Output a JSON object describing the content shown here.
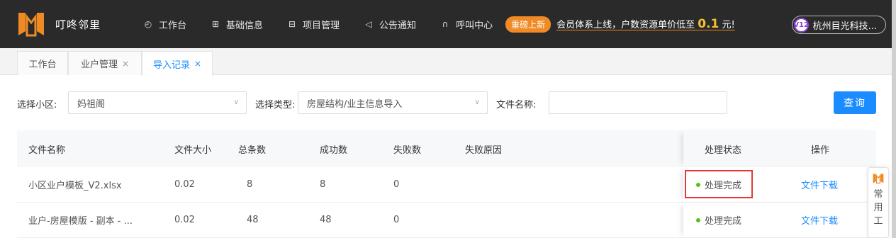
{
  "app": {
    "name": "叮咚邻里"
  },
  "nav": {
    "items": [
      {
        "label": "工作台",
        "icon": "clock-icon",
        "glyph": "◴"
      },
      {
        "label": "基础信息",
        "icon": "grid-icon",
        "glyph": "⊞"
      },
      {
        "label": "项目管理",
        "icon": "list-icon",
        "glyph": "⊟"
      },
      {
        "label": "公告通知",
        "icon": "megaphone-icon",
        "glyph": "◁"
      },
      {
        "label": "呼叫中心",
        "icon": "headset-icon",
        "glyph": "∩"
      }
    ]
  },
  "promo": {
    "badge": "重磅上新",
    "text_before": "会员体系上线，户数资源单价低至",
    "highlight": "0.1",
    "text_after": "元!"
  },
  "company": {
    "vip_level": "V12",
    "name": "杭州目光科技..."
  },
  "tabs": [
    {
      "label": "工作台",
      "closable": false,
      "active": false
    },
    {
      "label": "业户管理",
      "closable": true,
      "active": false
    },
    {
      "label": "导入记录",
      "closable": true,
      "active": true
    }
  ],
  "tab_close_glyph": "×",
  "filters": {
    "community_label": "选择小区:",
    "community_value": "妈祖阁",
    "type_label": "选择类型:",
    "type_value": "房屋结构/业主信息导入",
    "filename_label": "文件名称:",
    "filename_value": "",
    "query_button": "查询"
  },
  "table": {
    "columns": [
      "文件名称",
      "文件大小",
      "总条数",
      "成功数",
      "失败数",
      "失败原因",
      "处理状态",
      "操作"
    ],
    "rows": [
      {
        "file_name": "小区业户模板_V2.xlsx",
        "size": "0.02",
        "total": "8",
        "success": "8",
        "failed": "0",
        "reason": "",
        "status": "处理完成",
        "action": "文件下载"
      },
      {
        "file_name": "业户-房屋模版 - 副本 - ...",
        "size": "0.02",
        "total": "48",
        "success": "48",
        "failed": "0",
        "reason": "",
        "status": "处理完成",
        "action": "文件下载"
      }
    ]
  },
  "side_tool": {
    "chars": [
      "常",
      "用",
      "工"
    ]
  },
  "colors": {
    "accent": "#1a8cff",
    "topbar": "#2a2a2a",
    "brand_orange": "#f08a24",
    "status_green": "#52c41a",
    "highlight_red": "#e53935"
  }
}
